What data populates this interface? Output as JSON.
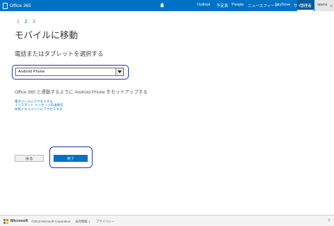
{
  "header": {
    "brand": "Office 365",
    "nav": [
      {
        "label": "Outlook",
        "left": 0
      },
      {
        "label": "予定表"
      },
      {
        "label": "People"
      },
      {
        "label": "ニュースフィード"
      },
      {
        "label": "SkyDrive"
      },
      {
        "label": "サイト"
      },
      {
        "label": "…"
      }
    ],
    "admin": "管理者",
    "user": "opera"
  },
  "steps": [
    "1",
    "2",
    "3"
  ],
  "title": "モバイルに移動",
  "subtitle": "電話またはタブレットを選択する",
  "select": {
    "value": "Android Phone"
  },
  "description": "Office 365 と連動するように Android Phone をセットアップする",
  "links": [
    "電子メールにアクセスする",
    "インスタント メッセージの送受信",
    "共有ドキュメントにアクセスする"
  ],
  "buttons": {
    "back": "戻る",
    "done": "完了"
  },
  "footer": {
    "microsoft": "Microsoft",
    "copyright": "©2013 Microsoft Corporation",
    "legal": "法的情報",
    "separator": "|",
    "privacy": "プライバシー",
    "help": "?"
  },
  "colors": {
    "accent": "#0072c6",
    "highlight": "#1f33a8"
  }
}
